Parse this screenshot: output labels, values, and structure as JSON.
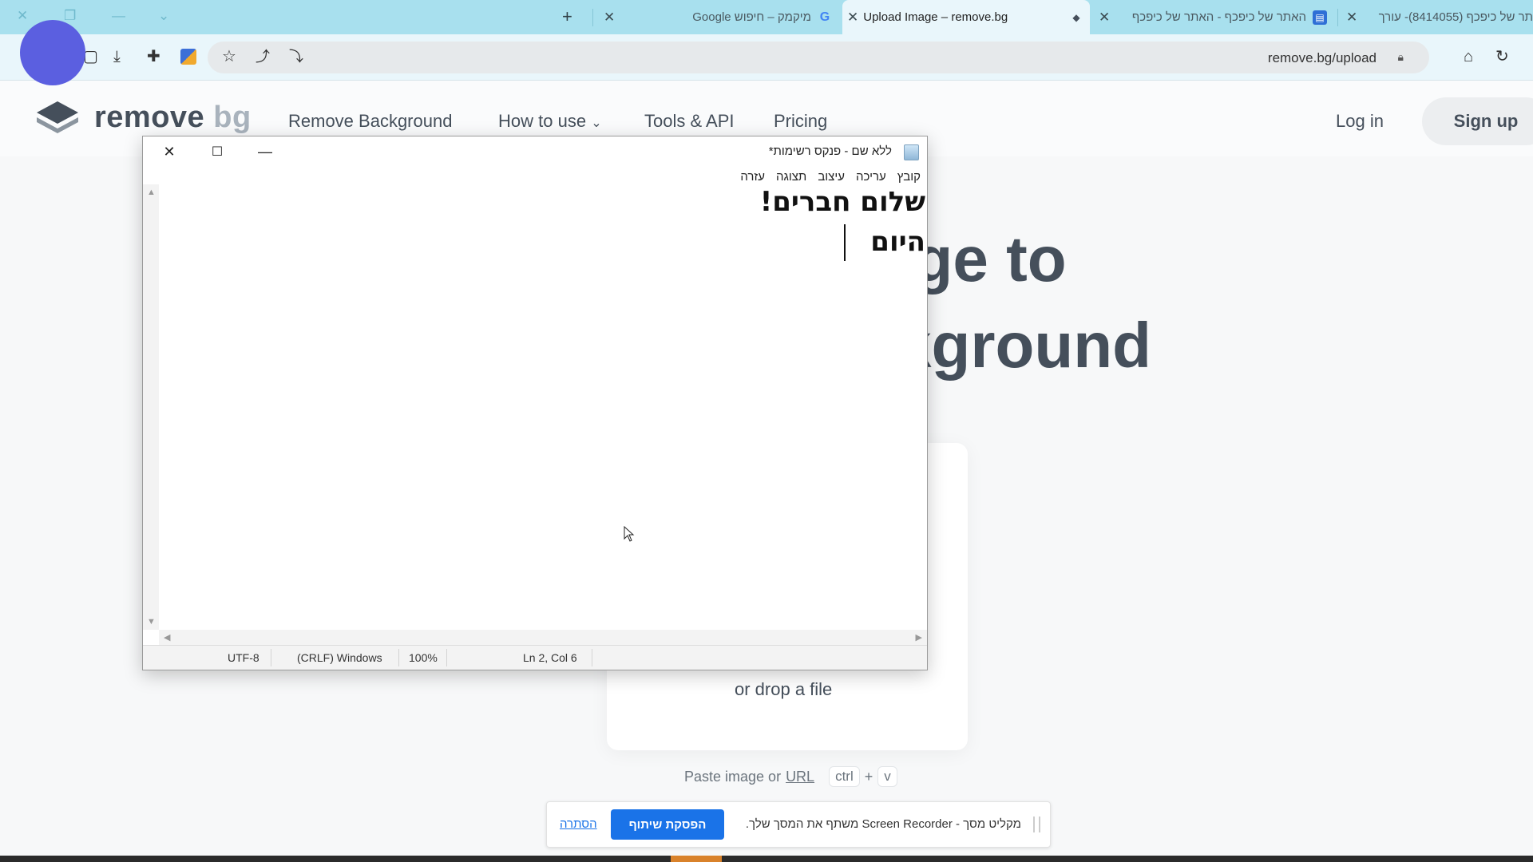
{
  "browser": {
    "tabs": [
      {
        "title": "תר של כיפכף (8414055)- עורך",
        "active": false
      },
      {
        "title": "האתר של כיפכף - האתר של כיפכף",
        "active": false
      },
      {
        "title": "Upload Image – remove.bg",
        "active": true
      },
      {
        "title": "מיקמק – חיפוש Google",
        "active": false
      }
    ],
    "new_tab_symbol": "+",
    "url": "remove.bg/upload",
    "colors": {
      "tabstrip": "#a8e0ee",
      "toolbar": "#e9f6fb",
      "avatar": "#5b5fe0"
    }
  },
  "site": {
    "logo_main": "remove",
    "logo_accent": "bg",
    "nav": [
      "Remove Background",
      "How to use",
      "Tools & API",
      "Pricing"
    ],
    "login": "Log in",
    "signup": "Sign up",
    "hero_line1": "age to",
    "hero_line2": "kground",
    "drop_text": "or drop a file",
    "paste_prefix": "Paste image or",
    "paste_url": "URL",
    "kbd_ctrl": "ctrl",
    "kbd_plus": "+",
    "kbd_v": "v"
  },
  "notepad": {
    "title": "ללא שם - פנקס רשימות*",
    "menu": [
      "קובץ",
      "עריכה",
      "עיצוב",
      "תצוגה",
      "עזרה"
    ],
    "lines": [
      "שלום חברים!",
      "היום"
    ],
    "status": {
      "position": "Ln 2, Col 6",
      "zoom": "100%",
      "line_ending": "(CRLF) Windows",
      "encoding": "UTF-8"
    }
  },
  "share_banner": {
    "message": "מקליט מסך - Screen Recorder משתף את המסך שלך.",
    "stop_label": "הפסקת שיתוף",
    "hide_label": "הסתרה",
    "accent": "#1a73e8"
  }
}
